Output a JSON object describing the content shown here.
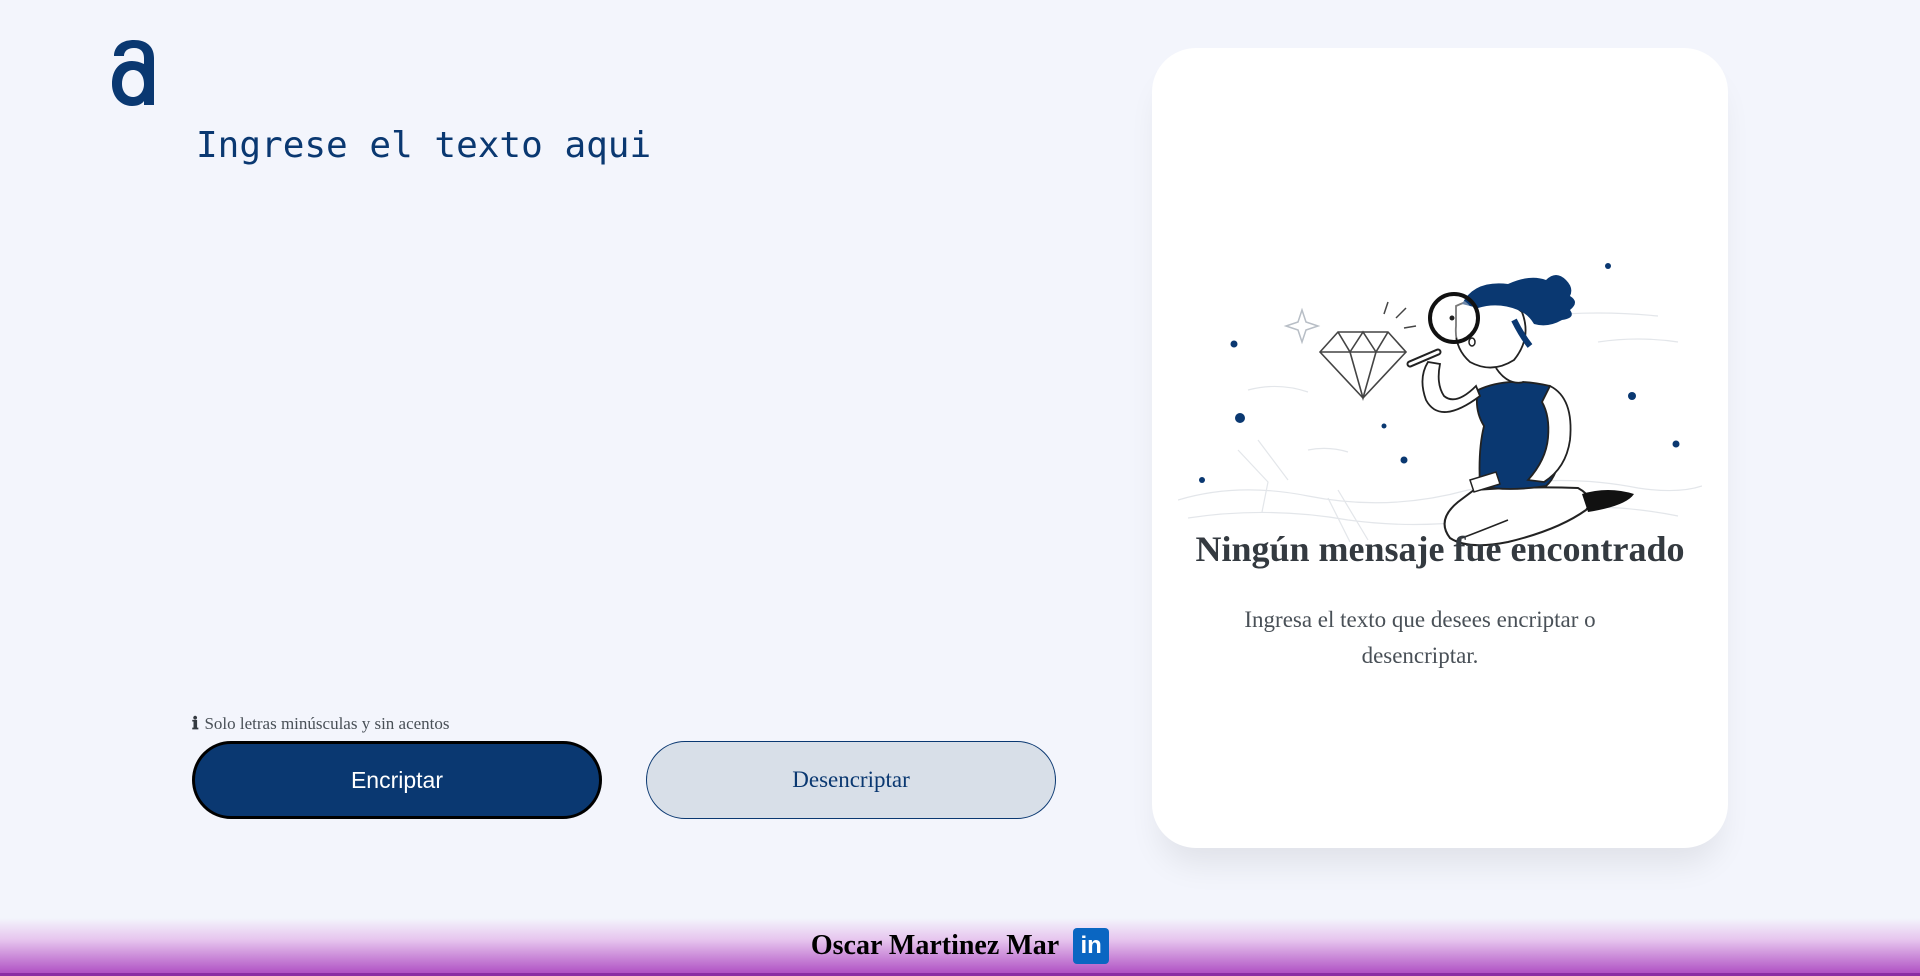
{
  "logo": {
    "icon": "alura-logo-icon"
  },
  "editor": {
    "placeholder": "Ingrese el texto aqui",
    "value": ""
  },
  "hint": {
    "icon": "info-icon",
    "text": "Solo letras minúsculas y sin acentos"
  },
  "buttons": {
    "encrypt_label": "Encriptar",
    "decrypt_label": "Desencriptar"
  },
  "result": {
    "illustration": "person-with-magnifier-illustration",
    "title": "Ningún mensaje fue encontrado",
    "description": "Ingresa el texto que desees encriptar o desencriptar."
  },
  "footer": {
    "author": "Oscar Martinez Mar",
    "linkedin_icon": "linkedin-icon"
  },
  "colors": {
    "primary": "#0a3871",
    "background": "#f3f5fc",
    "secondary_button": "#d8dfe8",
    "footer_gradient_end": "#b052c4",
    "linkedin": "#0a66c2"
  }
}
